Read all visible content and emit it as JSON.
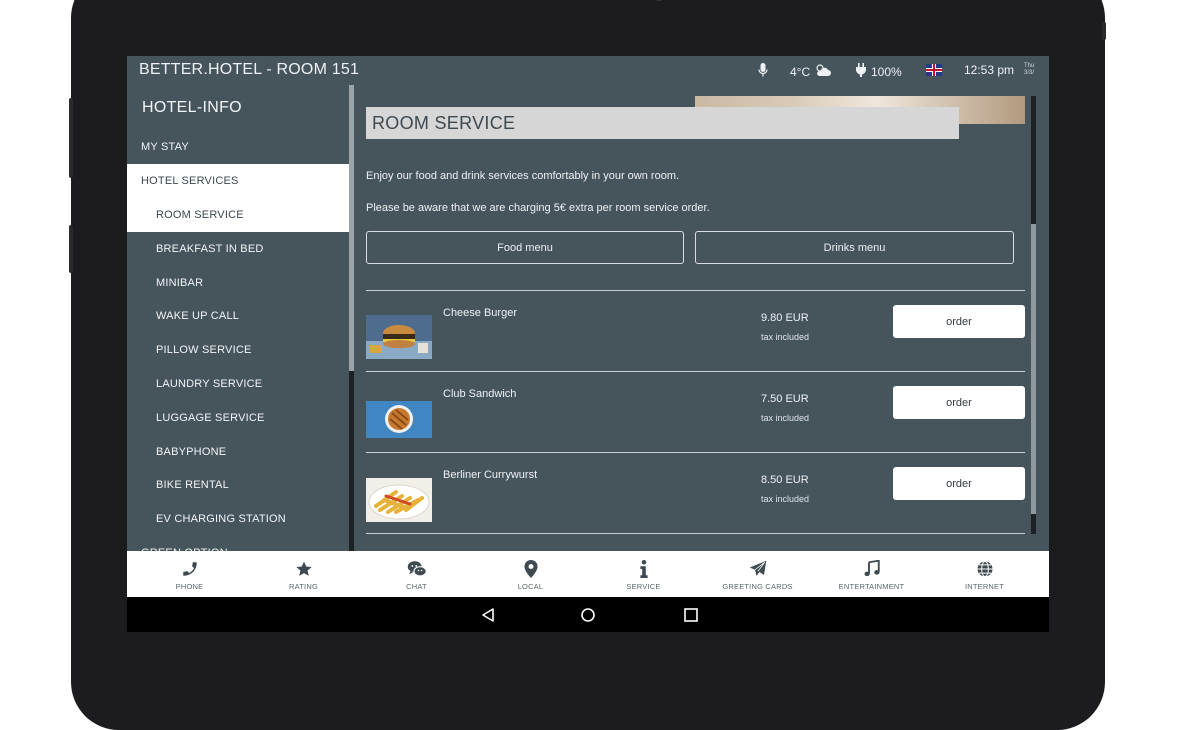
{
  "status_bar": {
    "title": "BETTER.HOTEL - ROOM 151",
    "temperature": "4°C",
    "battery": "100%",
    "time": "12:53 pm",
    "date_line1": "Thu",
    "date_line2": "3/3/",
    "icons": [
      "microphone-icon",
      "partly-cloudy-icon",
      "plug-icon",
      "uk-flag-icon"
    ]
  },
  "sidebar": {
    "header": "HOTEL-INFO",
    "items": [
      {
        "label": "MY STAY",
        "level": 1
      },
      {
        "label": "HOTEL SERVICES",
        "level": 1,
        "active": true
      },
      {
        "label": "ROOM SERVICE",
        "level": 2,
        "active": true
      },
      {
        "label": "BREAKFAST IN BED",
        "level": 2
      },
      {
        "label": "MINIBAR",
        "level": 2
      },
      {
        "label": "WAKE UP CALL",
        "level": 2
      },
      {
        "label": "PILLOW SERVICE",
        "level": 2
      },
      {
        "label": "LAUNDRY SERVICE",
        "level": 2
      },
      {
        "label": "LUGGAGE SERVICE",
        "level": 2
      },
      {
        "label": "BABYPHONE",
        "level": 2
      },
      {
        "label": "BIKE RENTAL",
        "level": 2
      },
      {
        "label": "EV CHARGING STATION",
        "level": 2
      },
      {
        "label": "GREEN OPTION",
        "level": 1
      }
    ]
  },
  "main": {
    "title": "ROOM SERVICE",
    "intro1": "Enjoy our food and drink services comfortably in your own room.",
    "intro2": "Please be aware that we are charging 5€ extra per room service order.",
    "food_menu_label": "Food menu",
    "drinks_menu_label": "Drinks menu",
    "items": [
      {
        "name": "Cheese Burger",
        "price": "9.80 EUR",
        "tax": "tax included",
        "order_label": "order"
      },
      {
        "name": "Club Sandwich",
        "price": "7.50 EUR",
        "tax": "tax included",
        "order_label": "order"
      },
      {
        "name": "Berliner Currywurst",
        "price": "8.50 EUR",
        "tax": "tax included",
        "order_label": "order"
      }
    ]
  },
  "tabbar": {
    "tabs": [
      {
        "label": "PHONE",
        "icon": "phone-icon"
      },
      {
        "label": "RATING",
        "icon": "star-icon"
      },
      {
        "label": "CHAT",
        "icon": "chat-icon"
      },
      {
        "label": "LOCAL",
        "icon": "location-pin-icon"
      },
      {
        "label": "SERVICE",
        "icon": "info-icon"
      },
      {
        "label": "GREETING CARDS",
        "icon": "paper-plane-icon"
      },
      {
        "label": "ENTERTAINMENT",
        "icon": "music-note-icon"
      },
      {
        "label": "INTERNET",
        "icon": "globe-icon"
      }
    ]
  },
  "colors": {
    "screen_bg": "#46545c",
    "title_box": "#d6d6d6",
    "active_item": "#ffffff",
    "tabbar_bg": "#ffffff",
    "navbar_bg": "#000000"
  }
}
